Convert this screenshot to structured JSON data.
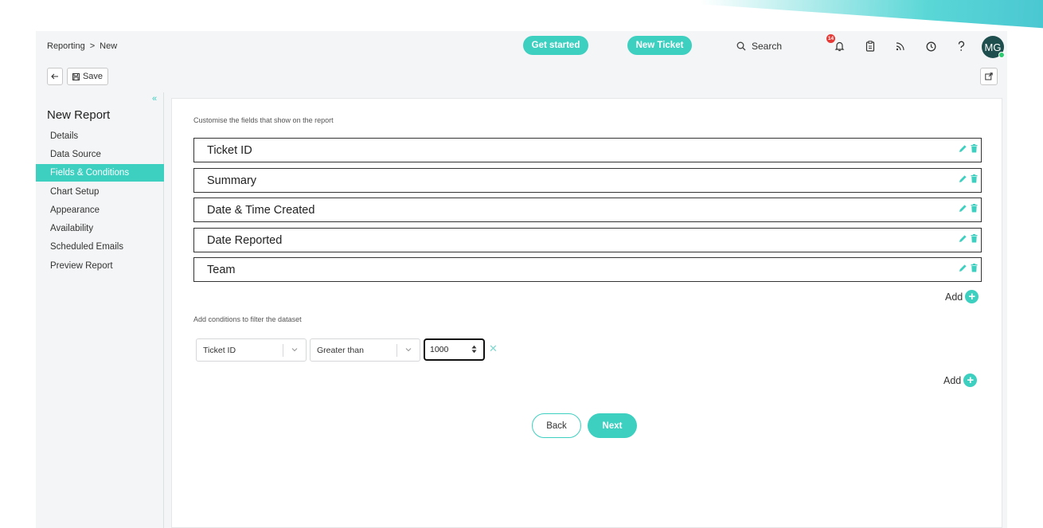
{
  "header": {
    "breadcrumb": [
      "Reporting",
      ">",
      "New"
    ],
    "get_started_label": "Get started",
    "new_ticket_label": "New Ticket",
    "search_label": "Search",
    "notification_count": "14",
    "avatar_initials": "MG"
  },
  "toolbar": {
    "save_label": "Save"
  },
  "sidebar": {
    "title": "New Report",
    "collapse_glyph": "«",
    "items": [
      {
        "label": "Details"
      },
      {
        "label": "Data Source"
      },
      {
        "label": "Fields & Conditions",
        "active": true
      },
      {
        "label": "Chart Setup"
      },
      {
        "label": "Appearance"
      },
      {
        "label": "Availability"
      },
      {
        "label": "Scheduled Emails"
      },
      {
        "label": "Preview Report"
      }
    ]
  },
  "fields_section": {
    "hint": "Customise the fields that show on the report",
    "fields": [
      "Ticket ID",
      "Summary",
      "Date & Time Created",
      "Date Reported",
      "Team"
    ],
    "add_label": "Add"
  },
  "conditions_section": {
    "hint": "Add conditions to filter the dataset",
    "conditions": [
      {
        "field": "Ticket ID",
        "operator": "Greater than",
        "value": "1000"
      }
    ],
    "add_label": "Add"
  },
  "footer": {
    "back_label": "Back",
    "next_label": "Next"
  },
  "colors": {
    "accent": "#3dcfc0",
    "avatar_bg": "#1e4f4e",
    "badge": "#e53935",
    "status_online": "#2ecc71"
  }
}
